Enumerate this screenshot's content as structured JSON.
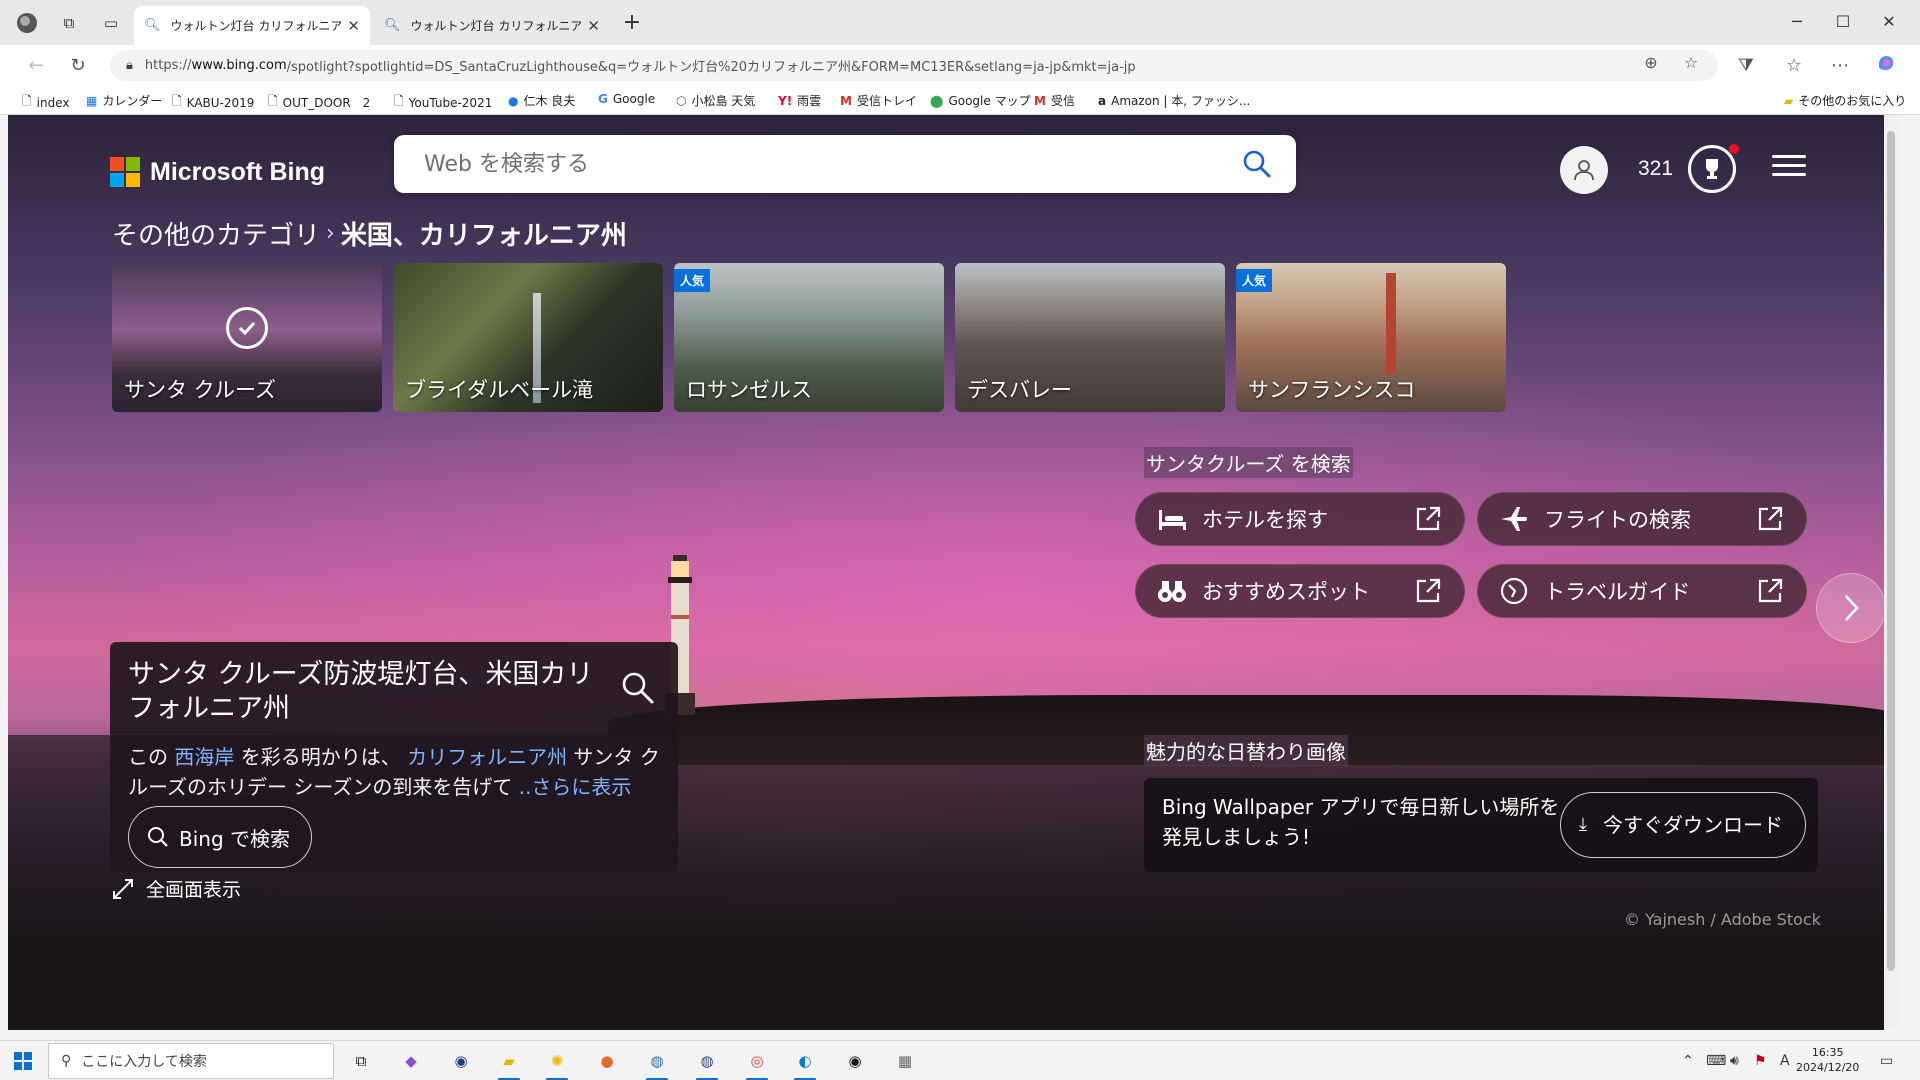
{
  "browser": {
    "tabs": [
      {
        "title": "ウォルトン灯台 カリフォルニア州 - 検索",
        "active": true
      },
      {
        "title": "ウォルトン灯台 カリフォルニア州 - 検索",
        "active": false
      }
    ],
    "url_prefix": "https://",
    "url_host": "www.bing.com",
    "url_rest": "/spotlight?spotlightid=DS_SantaCruzLighthouse&q=ウォルトン灯台%20カリフォルニア州&FORM=MC13ER&setlang=ja-jp&mkt=ja-jp",
    "bookmarks": [
      {
        "label": "index",
        "icon": "page-icon"
      },
      {
        "label": "カレンダー",
        "icon": "calendar-icon"
      },
      {
        "label": "KABU-2019",
        "icon": "page-icon"
      },
      {
        "label": "OUT_DOOR　2",
        "icon": "page-icon"
      },
      {
        "label": "YouTube-2021",
        "icon": "page-icon"
      },
      {
        "label": "仁木 良夫",
        "icon": "facebook-icon"
      },
      {
        "label": "Google",
        "icon": "google-icon"
      },
      {
        "label": "小松島 天気",
        "icon": "weather-icon"
      },
      {
        "label": "雨雲",
        "icon": "yahoo-icon"
      },
      {
        "label": "受信トレイ",
        "icon": "gmail-icon"
      },
      {
        "label": "Google マップ",
        "icon": "maps-pin-icon"
      },
      {
        "label": "受信",
        "icon": "gmail-icon"
      },
      {
        "label": "Amazon | 本, ファッシ...",
        "icon": "amazon-icon"
      }
    ],
    "other_favorites": "その他のお気に入り"
  },
  "bing": {
    "brand": "Microsoft Bing",
    "search_placeholder": "Web を検索する",
    "points": "321",
    "breadcrumb": {
      "parent": "その他のカテゴリ",
      "current": "米国、カリフォルニア州"
    },
    "cards": [
      {
        "label": "サンタ クルーズ",
        "badge": "",
        "selected": true
      },
      {
        "label": "ブライダルベール滝",
        "badge": "",
        "selected": false
      },
      {
        "label": "ロサンゼルス",
        "badge": "人気",
        "selected": false
      },
      {
        "label": "デスバレー",
        "badge": "",
        "selected": false
      },
      {
        "label": "サンフランシスコ",
        "badge": "人気",
        "selected": false
      }
    ],
    "search_section_title": "サンタクルーズ を検索",
    "actions": [
      {
        "label": "ホテルを探す",
        "icon": "bed-icon"
      },
      {
        "label": "フライトの検索",
        "icon": "airplane-icon"
      },
      {
        "label": "おすすめスポット",
        "icon": "binoculars-icon"
      },
      {
        "label": "トラベルガイド",
        "icon": "compass-icon"
      }
    ],
    "info": {
      "title": "サンタ クルーズ防波堤灯台、米国カリフォルニア州",
      "body_1": "この ",
      "link_1": "西海岸",
      "body_2": " を彩る明かりは、 ",
      "link_2": "カリフォルニア州",
      "body_3": " サンタ クルーズのホリデー シーズンの到来を告げて ",
      "more": "..さらに表示",
      "search_button": "Bing で検索"
    },
    "fullscreen": "全画面表示",
    "daily_title": "魅力的な日替わり画像",
    "wallpaper_text": "Bing Wallpaper アプリで毎日新しい場所を発見しましょう!",
    "download_button": "今すぐダウンロード",
    "credit": "© Yajnesh / Adobe Stock"
  },
  "taskbar": {
    "search_placeholder": "ここに入力して検索",
    "time": "16:35",
    "date": "2024/12/20",
    "ime": "A"
  }
}
